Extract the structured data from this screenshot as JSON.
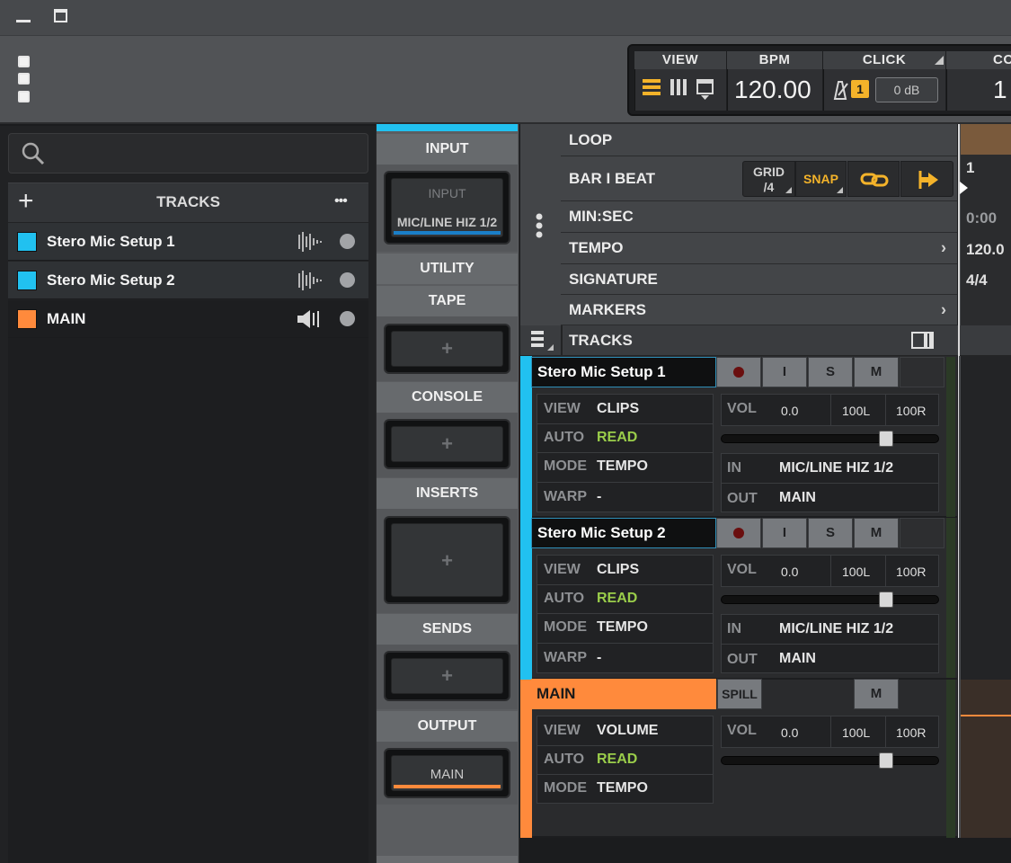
{
  "transport": {
    "view_label": "VIEW",
    "bpm_label": "BPM",
    "bpm_value": "120.00",
    "click_label": "CLICK",
    "click_count": "1",
    "click_level": "0 dB",
    "extra_label": "CO",
    "extra_value": "1"
  },
  "browser": {
    "search_placeholder": "",
    "tracks_title": "TRACKS",
    "add_symbol": "+",
    "more_symbol": "•••",
    "tracks": [
      {
        "name": "Stero Mic Setup 1",
        "color": "#21c1f0",
        "icon": "waveform-icon"
      },
      {
        "name": "Stero Mic Setup 2",
        "color": "#21c1f0",
        "icon": "waveform-icon"
      },
      {
        "name": "MAIN",
        "color": "#ff8a3c",
        "icon": "speaker-icon"
      }
    ]
  },
  "strip": {
    "input_head": "INPUT",
    "input_label": "INPUT",
    "input_value": "MIC/LINE HIZ 1/2",
    "utility_head": "UTILITY",
    "tape_head": "TAPE",
    "console_head": "CONSOLE",
    "inserts_head": "INSERTS",
    "sends_head": "SENDS",
    "output_head": "OUTPUT",
    "output_value": "MAIN",
    "plus": "+"
  },
  "timeline": {
    "loop": "LOOP",
    "bar_beat": "BAR I BEAT",
    "grid_label": "GRID",
    "grid_value": "/4",
    "snap_label": "SNAP",
    "min_sec": "MIN:SEC",
    "tempo": "TEMPO",
    "signature": "SIGNATURE",
    "markers": "MARKERS",
    "ruler_bar": "1",
    "ruler_time": "0:00",
    "ruler_tempo": "120.0",
    "ruler_sig": "4/4"
  },
  "tracks_header": "TRACKS",
  "track_cards": [
    {
      "name": "Stero Mic Setup 1",
      "color": "#21c1f0",
      "btn_i": "I",
      "btn_s": "S",
      "btn_m": "M",
      "view_k": "VIEW",
      "view_v": "CLIPS",
      "auto_k": "AUTO",
      "auto_v": "READ",
      "mode_k": "MODE",
      "mode_v": "TEMPO",
      "warp_k": "WARP",
      "warp_v": "-",
      "vol_k": "VOL",
      "vol_v": "0.0",
      "pan_l": "100L",
      "pan_r": "100R",
      "in_k": "IN",
      "in_v": "MIC/LINE HIZ 1/2",
      "out_k": "OUT",
      "out_v": "MAIN"
    },
    {
      "name": "Stero Mic Setup 2",
      "color": "#21c1f0",
      "btn_i": "I",
      "btn_s": "S",
      "btn_m": "M",
      "view_k": "VIEW",
      "view_v": "CLIPS",
      "auto_k": "AUTO",
      "auto_v": "READ",
      "mode_k": "MODE",
      "mode_v": "TEMPO",
      "warp_k": "WARP",
      "warp_v": "-",
      "vol_k": "VOL",
      "vol_v": "0.0",
      "pan_l": "100L",
      "pan_r": "100R",
      "in_k": "IN",
      "in_v": "MIC/LINE HIZ 1/2",
      "out_k": "OUT",
      "out_v": "MAIN"
    }
  ],
  "main_card": {
    "name": "MAIN",
    "color": "#ff8a3c",
    "spill": "SPILL",
    "btn_m": "M",
    "view_k": "VIEW",
    "view_v": "VOLUME",
    "auto_k": "AUTO",
    "auto_v": "READ",
    "mode_k": "MODE",
    "mode_v": "TEMPO",
    "vol_k": "VOL",
    "vol_v": "0.0",
    "pan_l": "100L",
    "pan_r": "100R"
  }
}
